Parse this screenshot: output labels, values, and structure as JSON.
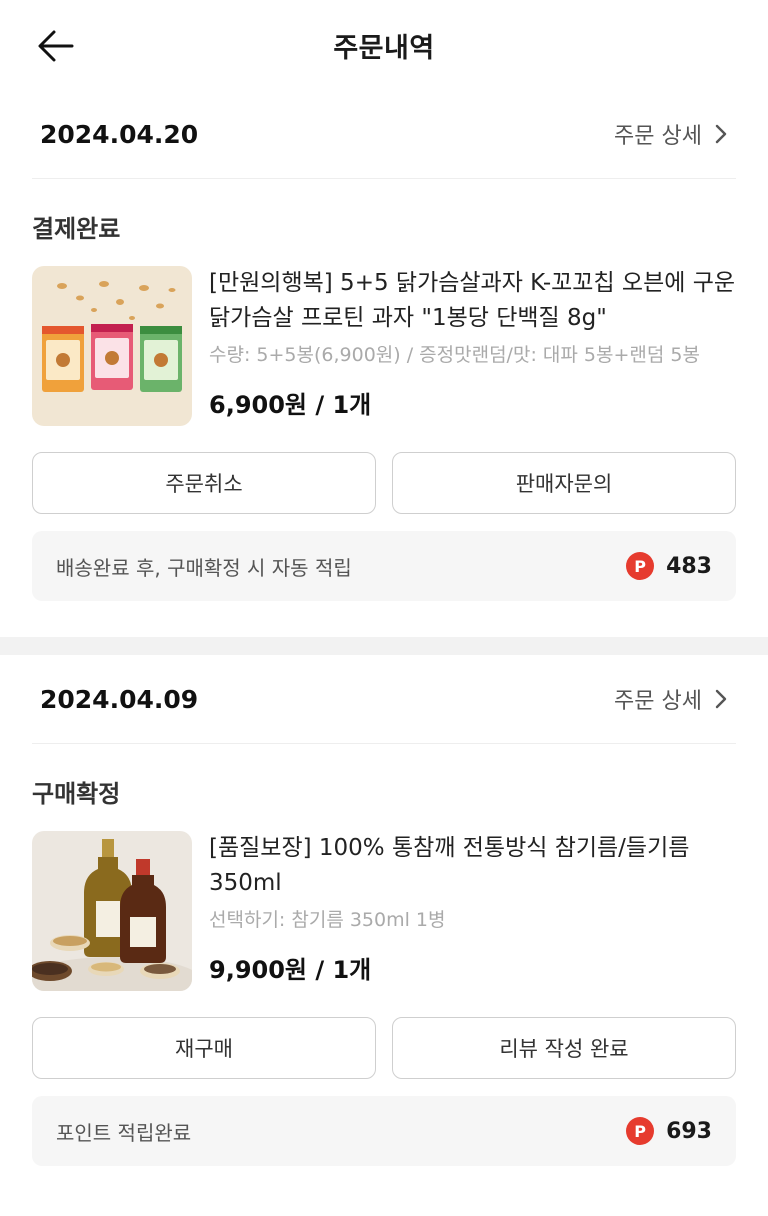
{
  "header": {
    "title": "주문내역"
  },
  "orders": [
    {
      "date": "2024.04.20",
      "detail_label": "주문 상세",
      "status": "결제완료",
      "product_name": "[만원의행복] 5+5 닭가슴살과자 K-꼬꼬칩 오븐에 구운 닭가슴살 프로틴 과자 \"1봉당 단백질 8g\"",
      "option": "수량: 5+5봉(6,900원) / 증정맛랜덤/맛: 대파 5봉+랜덤 5봉",
      "price": "6,900원 / 1개",
      "button_left": "주문취소",
      "button_right": "판매자문의",
      "points_text": "배송완료 후, 구매확정 시 자동 적립",
      "points_badge": "P",
      "points_value": "483"
    },
    {
      "date": "2024.04.09",
      "detail_label": "주문 상세",
      "status": "구매확정",
      "product_name": "[품질보장] 100% 통참깨 전통방식 참기름/들기름 350ml",
      "option": "선택하기: 참기름 350ml 1병",
      "price": "9,900원 / 1개",
      "button_left": "재구매",
      "button_right": "리뷰 작성 완료",
      "points_text": "포인트 적립완료",
      "points_badge": "P",
      "points_value": "693"
    }
  ],
  "colors": {
    "point_badge": "#e63b2e",
    "section_divider": "#f2f2f2",
    "points_bg": "#f6f6f6"
  },
  "icons": {
    "back": "arrow-left-icon",
    "detail": "chevron-right-icon"
  }
}
